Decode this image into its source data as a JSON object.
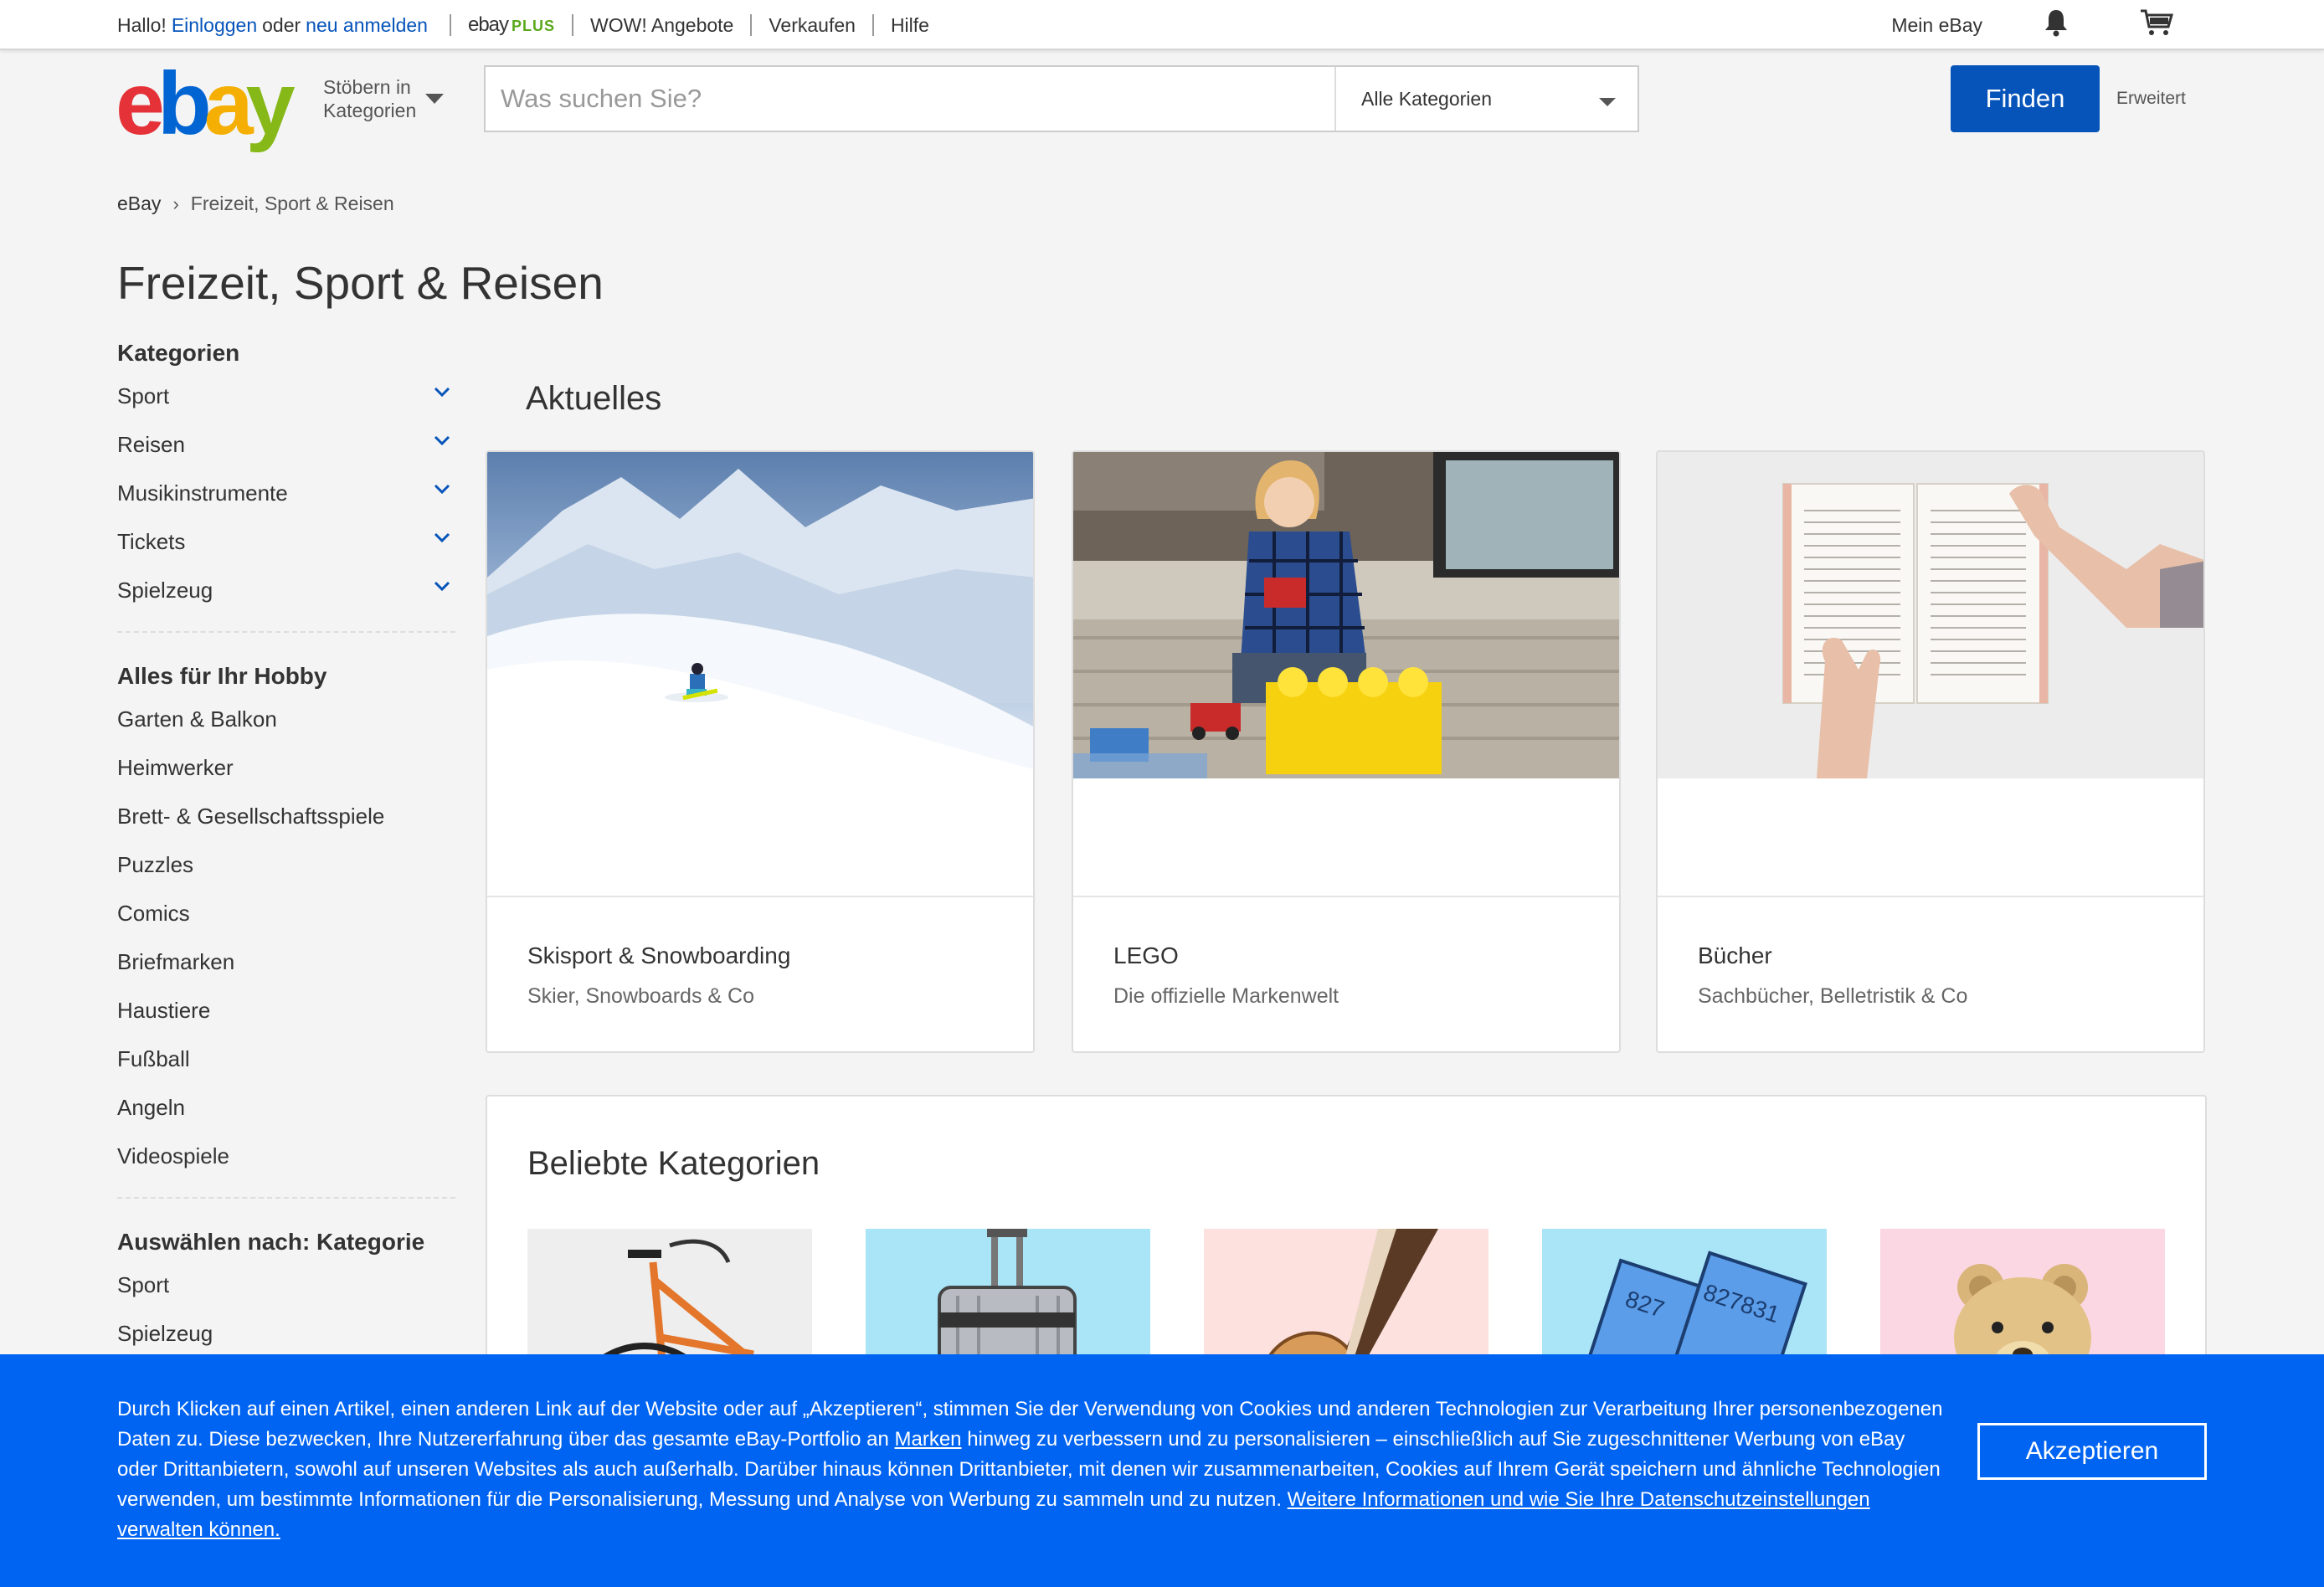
{
  "topbar": {
    "greeting": "Hallo!",
    "login": "Einloggen",
    "or": "oder",
    "register": "neu anmelden",
    "plus_logo_ebay": "ebay",
    "plus_logo_plus": "PLUS",
    "links": [
      "WOW! Angebote",
      "Verkaufen",
      "Hilfe"
    ],
    "my_ebay": "Mein eBay",
    "bell_icon": "bell-icon",
    "cart_icon": "cart-icon"
  },
  "header": {
    "logo_letters": [
      "e",
      "b",
      "a",
      "y"
    ],
    "browse_line1": "Stöbern in",
    "browse_line2": "Kategorien",
    "search_placeholder": "Was suchen Sie?",
    "category_select": "Alle Kategorien",
    "find_button": "Finden",
    "advanced": "Erweitert"
  },
  "colors": {
    "brand_red": "#e53238",
    "brand_blue": "#0064d2",
    "brand_yellow": "#f5af02",
    "brand_green": "#86b817",
    "button_blue": "#0654ba",
    "cookie_blue": "#0064f2",
    "link_blue": "#0654ba"
  },
  "breadcrumb": {
    "home": "eBay",
    "current": "Freizeit, Sport & Reisen"
  },
  "page_title": "Freizeit, Sport & Reisen",
  "sidebar": {
    "categories_heading": "Kategorien",
    "categories": [
      "Sport",
      "Reisen",
      "Musikinstrumente",
      "Tickets",
      "Spielzeug"
    ],
    "hobby_heading": "Alles für Ihr Hobby",
    "hobby_items": [
      "Garten & Balkon",
      "Heimwerker",
      "Brett- & Gesellschaftsspiele",
      "Puzzles",
      "Comics",
      "Briefmarken",
      "Haustiere",
      "Fußball",
      "Angeln",
      "Videospiele"
    ],
    "select_heading": "Auswählen nach: Kategorie",
    "select_items": [
      "Sport",
      "Spielzeug"
    ]
  },
  "aktuelles": {
    "title": "Aktuelles",
    "cards": [
      {
        "title": "Skisport & Snowboarding",
        "subtitle": "Skier, Snowboards & Co"
      },
      {
        "title": "LEGO",
        "subtitle": "Die offizielle Markenwelt"
      },
      {
        "title": "Bücher",
        "subtitle": "Sachbücher, Belletristik & Co"
      }
    ]
  },
  "popular": {
    "title": "Beliebte Kategorien",
    "ticket_number": "827831",
    "ticket_number_partial": "827"
  },
  "cookie": {
    "text_part1": "Durch Klicken auf einen Artikel, einen anderen Link auf der Website oder auf „Akzeptieren“, stimmen Sie der Verwendung von Cookies und anderen Technologien zur Verarbeitung Ihrer personenbezogenen Daten zu. Diese bezwecken, Ihre Nutzererfahrung über das gesamte eBay-Portfolio an ",
    "link_marken": "Marken",
    "text_part2": " hinweg zu verbessern und zu personalisieren – einschließlich auf Sie zugeschnittener Werbung von eBay oder Drittanbietern, sowohl auf unseren Websites als auch außerhalb. Darüber hinaus können Drittanbieter, mit denen wir zusammenarbeiten, Cookies auf Ihrem Gerät speichern und ähnliche Technologien verwenden, um bestimmte Informationen für die Personalisierung, Messung und Analyse von Werbung zu sammeln und zu nutzen. ",
    "link_more": "Weitere Informationen und wie Sie Ihre Datenschutzeinstellungen verwalten können.",
    "accept_button": "Akzeptieren"
  }
}
